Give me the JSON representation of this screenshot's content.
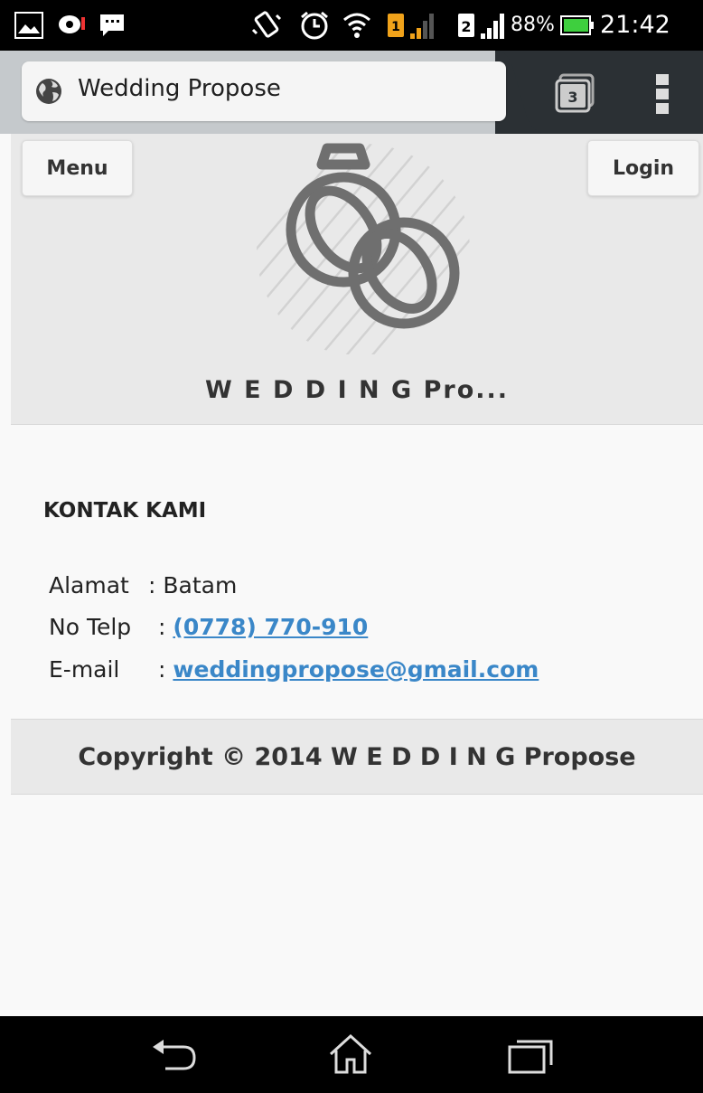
{
  "status_bar": {
    "battery_percent": "88%",
    "time": "21:42",
    "sim2_label": "2",
    "sim1_label": "1",
    "icons": [
      "gallery-icon",
      "bbm-icon",
      "chat-icon",
      "vibrate-icon",
      "alarm-icon",
      "wifi-icon",
      "sim1-icon",
      "signal-icon",
      "sim2-icon",
      "signal-icon",
      "battery-icon"
    ]
  },
  "browser": {
    "page_title": "Wedding Propose",
    "tab_count": "3"
  },
  "header": {
    "menu_label": "Menu",
    "login_label": "Login",
    "site_title": "W E D D I N G Pro..."
  },
  "contact": {
    "title": "KONTAK KAMI",
    "address_label": "Alamat",
    "address_sep": ":",
    "address_value": "Batam",
    "phone_label": "No Telp",
    "phone_sep": ":",
    "phone_value": "(0778) 770-910",
    "email_label": "E-mail",
    "email_sep": ":",
    "email_value": "weddingpropose@gmail.com",
    "link_color": "#3a87c8"
  },
  "footer": {
    "copyright": "Copyright © 2014 W E D D I N G Propose"
  },
  "nav_bar": {
    "buttons": [
      "back-icon",
      "home-icon",
      "recent-apps-icon"
    ]
  }
}
